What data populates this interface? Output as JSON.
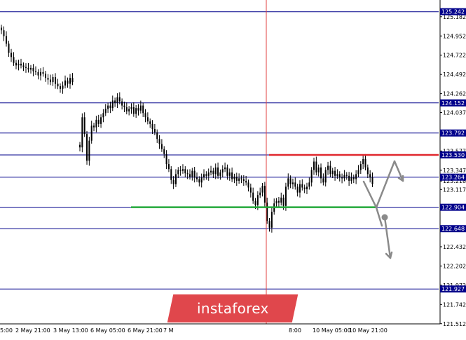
{
  "watermark": {
    "text": "instaforex"
  },
  "colors": {
    "candle": "#000000",
    "level_line": "#00008b",
    "level_label_bg": "#00008b",
    "resistance": "#e0282e",
    "support": "#22a83a",
    "forecast_arrow": "#8a8a8a",
    "vertical_marker": "#e04040",
    "watermark_bg": "#e0474c"
  },
  "chart_data": {
    "type": "candlestick",
    "title": "",
    "xlabel": "",
    "ylabel": "",
    "ylim": [
      121.51,
      125.34
    ],
    "grid": false,
    "y_ticks": [
      "125.182",
      "124.952",
      "124.722",
      "124.492",
      "124.262",
      "124.037",
      "123.807",
      "123.577",
      "123.347",
      "123.218",
      "123.117",
      "122.887",
      "122.432",
      "122.202",
      "121.972",
      "121.742",
      "121.512"
    ],
    "x_ticks": [
      "5:00",
      "2 May 21:00",
      "3 May 13:00",
      "6 May 05:00",
      "6 May 21:00",
      "7 M",
      "8:00",
      "10 May 05:00",
      "10 May 21:00"
    ],
    "levels": [
      {
        "value": 125.242,
        "label": "125.242"
      },
      {
        "value": 124.152,
        "label": "124.152"
      },
      {
        "value": 123.792,
        "label": "123.792"
      },
      {
        "value": 123.53,
        "label": "123.530"
      },
      {
        "value": 123.264,
        "label": "123.264"
      },
      {
        "value": 122.904,
        "label": "122.904"
      },
      {
        "value": 122.648,
        "label": "122.648"
      },
      {
        "value": 121.927,
        "label": "121.927"
      }
    ],
    "series": [
      {
        "values": [
          125.02,
          124.95,
          124.86,
          124.75,
          124.7,
          124.63,
          124.6,
          124.62,
          124.6,
          124.58,
          124.57,
          124.55,
          124.57,
          124.53,
          124.52,
          124.48,
          124.52,
          124.5,
          124.45,
          124.43,
          124.4,
          124.46,
          124.38,
          124.35,
          124.32,
          124.36,
          124.42,
          124.38,
          124.45,
          124.4
        ]
      },
      {
        "values": [
          123.62,
          123.98,
          123.78,
          123.46,
          123.7,
          123.88,
          123.86,
          123.95,
          123.9,
          123.98,
          124.03,
          124.08,
          124.12,
          124.09,
          124.18,
          124.15,
          124.22,
          124.17,
          124.12,
          124.1,
          124.05,
          124.08,
          124.1,
          124.02,
          124.09,
          124.06,
          124.12,
          124.03,
          123.98,
          123.93,
          123.9,
          123.84,
          123.8,
          123.72,
          123.66,
          123.6,
          123.54,
          123.42,
          123.36,
          123.23,
          123.18,
          123.3,
          123.35,
          123.34,
          123.36,
          123.31,
          123.3,
          123.27,
          123.34,
          123.26,
          123.24,
          123.2,
          123.26,
          123.3,
          123.28,
          123.32,
          123.34,
          123.3,
          123.38,
          123.28,
          123.32,
          123.36,
          123.38,
          123.28,
          123.32,
          123.24,
          123.27,
          123.22,
          123.25,
          123.24,
          123.22,
          123.2,
          123.14,
          123.08,
          122.98,
          122.93,
          123.05,
          123.08,
          123.16,
          122.96,
          122.74,
          122.66,
          122.85,
          122.95,
          122.98,
          122.96,
          123.02,
          122.92,
          123.15,
          123.25,
          123.18,
          123.2,
          123.15,
          123.08,
          123.18,
          123.14,
          123.12,
          123.15,
          123.2,
          123.35,
          123.45,
          123.32,
          123.38,
          123.25,
          123.2,
          123.35,
          123.4,
          123.3,
          123.34,
          123.28,
          123.3,
          123.26,
          123.25,
          123.29,
          123.28,
          123.22,
          123.26,
          123.24,
          123.3,
          123.35,
          123.42,
          123.48,
          123.38,
          123.3,
          123.26,
          123.18
        ]
      }
    ],
    "annotations": {
      "resistance_line": {
        "value": 123.53
      },
      "support_line": {
        "value": 122.904
      },
      "vertical_marker": {
        "x_label": "8:00"
      }
    }
  }
}
